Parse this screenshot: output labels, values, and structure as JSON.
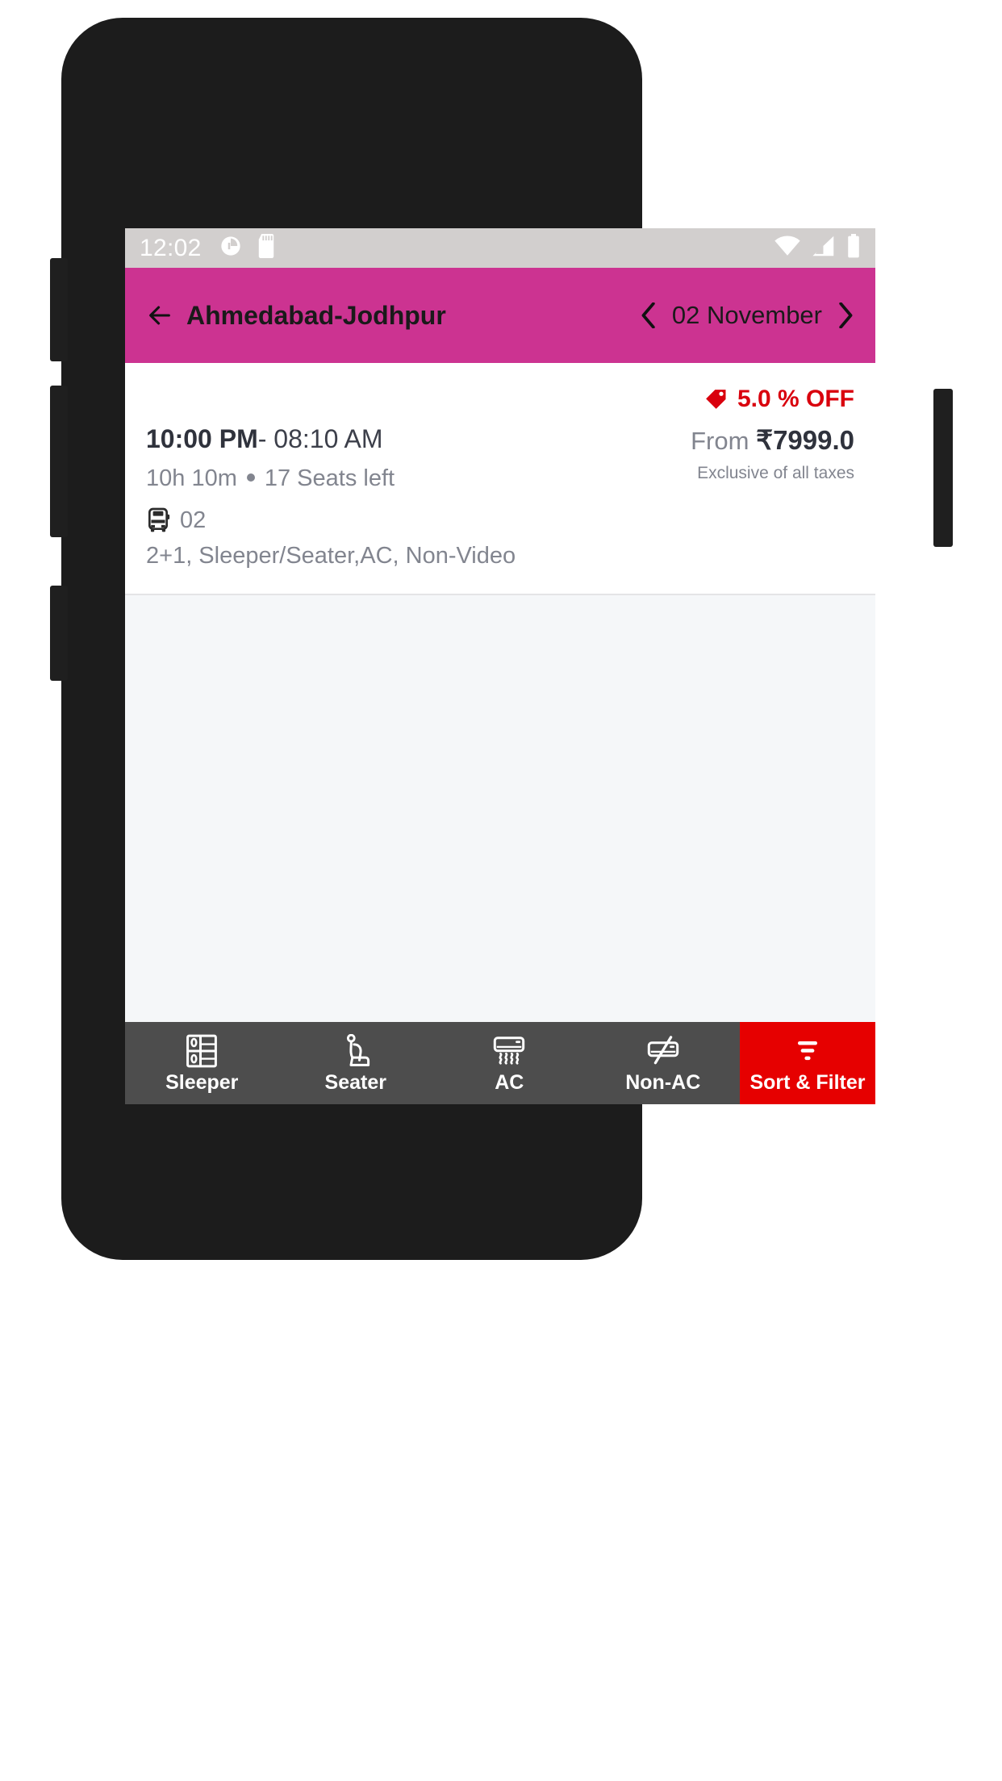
{
  "status_bar": {
    "time": "12:02",
    "icons_left": [
      "data-saver-icon",
      "sd-card-icon"
    ],
    "icons_right": [
      "wifi-icon",
      "cellular-signal-icon",
      "battery-icon"
    ],
    "background_color": "#d2cfce"
  },
  "app_bar": {
    "back_icon": "arrow-left-icon",
    "route_title": "Ahmedabad-Jodhpur",
    "date": "02 November",
    "prev_icon": "chevron-left-icon",
    "next_icon": "chevron-right-icon",
    "background_color": "#cc3391"
  },
  "results": {
    "background_color": "#f5f7f9",
    "buses": [
      {
        "discount_icon": "price-tag-icon",
        "discount": "5.0 % OFF",
        "discount_color": "#d9000d",
        "departure_time": "10:00 PM",
        "separator": "-",
        "arrival_time": "08:10 AM",
        "duration": "10h 10m",
        "seats_left": "17 Seats left",
        "bus_icon": "bus-front-icon",
        "bus_number": "02",
        "amenities": "2+1, Sleeper/Seater,AC, Non-Video",
        "price_prefix": "From",
        "currency": "₹",
        "price": "7999.0",
        "tax_note": "Exclusive of all taxes"
      }
    ]
  },
  "filter_bar": {
    "background_color": "#4d4d4d",
    "accent_color": "#e60000",
    "items": [
      {
        "label": "Sleeper",
        "icon": "sleeper-berth-icon",
        "accent": false
      },
      {
        "label": "Seater",
        "icon": "seat-icon",
        "accent": false
      },
      {
        "label": "AC",
        "icon": "air-conditioner-icon",
        "accent": false
      },
      {
        "label": "Non-AC",
        "icon": "air-conditioner-off-icon",
        "accent": false
      },
      {
        "label": "Sort & Filter",
        "icon": "filter-funnel-icon",
        "accent": true
      }
    ]
  },
  "nav_bar": {
    "background_color": "#000000",
    "buttons": [
      {
        "name": "back-button",
        "icon": "triangle-left-icon"
      },
      {
        "name": "home-button",
        "icon": "circle-icon"
      },
      {
        "name": "recents-button",
        "icon": "square-icon"
      }
    ]
  }
}
